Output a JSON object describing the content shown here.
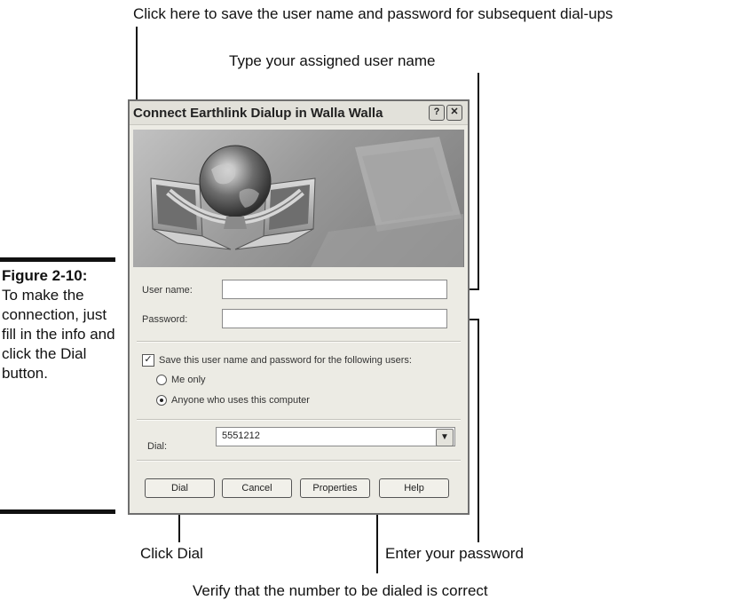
{
  "callouts": {
    "save_credentials": "Click here to save the user name and password for subsequent dial-ups",
    "type_user": "Type your assigned user name",
    "click_dial": "Click Dial",
    "enter_password": "Enter your password",
    "verify_number": "Verify that the number to be dialed is correct"
  },
  "figure": {
    "title": "Figure 2-10:",
    "caption": "To make the connection, just fill in the info and click the Dial button."
  },
  "dialog": {
    "title": "Connect Earthlink Dialup in Walla Walla",
    "help_glyph": "?",
    "close_glyph": "✕",
    "username_label": "User name:",
    "username_value": "",
    "password_label": "Password:",
    "password_value": "",
    "save_label": "Save this user name and password for the following users:",
    "save_checked": true,
    "radio_me": "Me only",
    "radio_anyone": "Anyone who uses this computer",
    "dial_label": "Dial:",
    "dial_value": "5551212",
    "buttons": {
      "dial": "Dial",
      "cancel": "Cancel",
      "properties": "Properties",
      "help": "Help"
    }
  }
}
